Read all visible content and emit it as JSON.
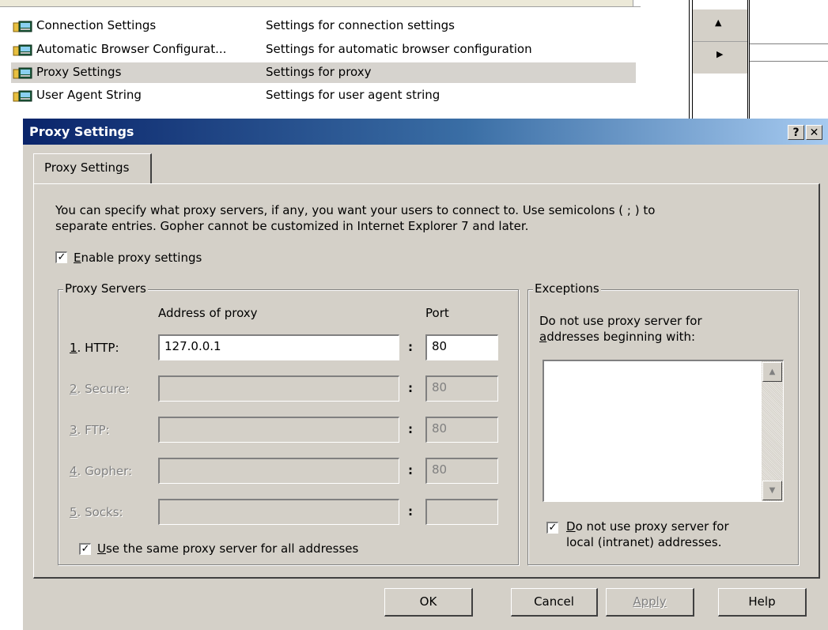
{
  "background_list": {
    "rows": [
      {
        "name": "Connection Settings",
        "desc": "Settings for connection settings",
        "selected": false
      },
      {
        "name": "Automatic Browser Configurat...",
        "desc": "Settings for automatic browser configuration",
        "selected": false
      },
      {
        "name": "Proxy Settings",
        "desc": "Settings for proxy",
        "selected": true
      },
      {
        "name": "User Agent String",
        "desc": "Settings for user agent string",
        "selected": false
      }
    ]
  },
  "dialog": {
    "title": "Proxy Settings",
    "help_btn": "?",
    "close_btn": "✕",
    "tab_label": "Proxy Settings",
    "description_line1": "You can specify what proxy servers, if any, you want your users to connect to. Use semicolons ( ; ) to",
    "description_line2": "separate entries. Gopher cannot be customized in Internet Explorer 7 and later.",
    "enable_proxy": {
      "label_underline": "E",
      "label_rest": "nable proxy settings",
      "checked": true
    },
    "proxy_servers": {
      "title": "Proxy Servers",
      "address_header": "Address of proxy",
      "port_header": "Port",
      "colon": ":",
      "rows": [
        {
          "key": "1",
          "label": ". HTTP:",
          "address": "127.0.0.1",
          "port": "80",
          "enabled": true
        },
        {
          "key": "2",
          "label": ". Secure:",
          "address": "",
          "port": "80",
          "enabled": false
        },
        {
          "key": "3",
          "label": ". FTP:",
          "address": "",
          "port": "80",
          "enabled": false
        },
        {
          "key": "4",
          "label": ". Gopher:",
          "address": "",
          "port": "80",
          "enabled": false
        },
        {
          "key": "5",
          "label": ". Socks:",
          "address": "",
          "port": "",
          "enabled": false
        }
      ],
      "same_proxy": {
        "label_underline": "U",
        "label_rest": "se the same proxy server for all addresses",
        "checked": true
      }
    },
    "exceptions": {
      "title": "Exceptions",
      "line1": "Do not use proxy server for",
      "line2_underline": "a",
      "line2_rest": "ddresses beginning with:",
      "list_value": "",
      "local": {
        "line1_underline": "D",
        "line1_rest": "o not use proxy server for",
        "line2": "local (intranet) addresses.",
        "checked": true
      }
    },
    "buttons": {
      "ok": "OK",
      "cancel": "Cancel",
      "apply": "Apply",
      "help": "Help"
    }
  }
}
